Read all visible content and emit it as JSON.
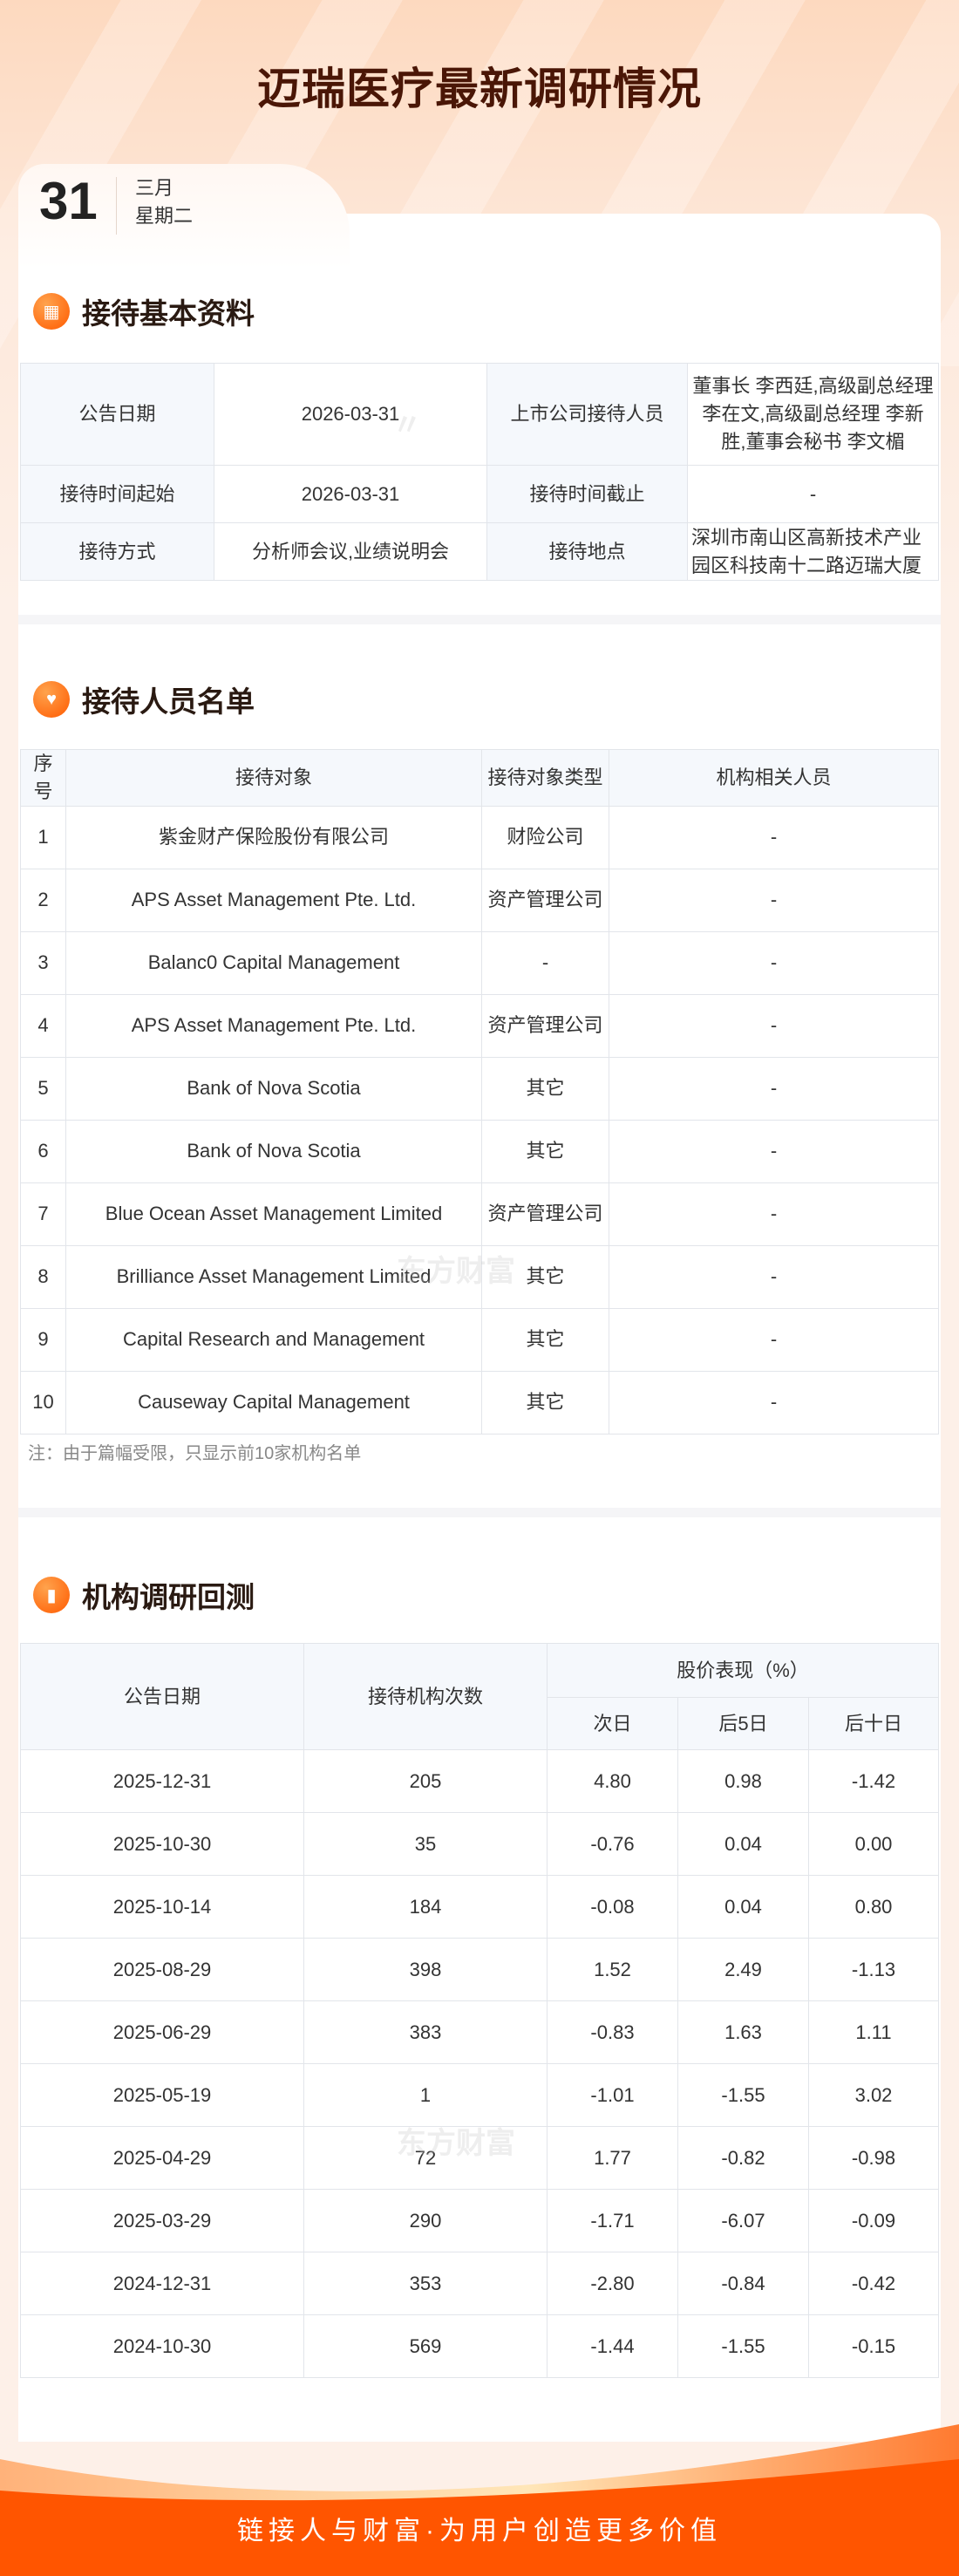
{
  "title": "迈瑞医疗最新调研情况",
  "date": {
    "day": "31",
    "month": "三月",
    "weekday": "星期二"
  },
  "section1": {
    "title": "接待基本资料",
    "rows": [
      [
        "公告日期",
        "2026-03-31",
        "上市公司接待人员",
        "董事长 李西廷,高级副总经理 李在文,高级副总经理 李新胜,董事会秘书 李文楣"
      ],
      [
        "接待时间起始",
        "2026-03-31",
        "接待时间截止",
        "-"
      ],
      [
        "接待方式",
        "分析师会议,业绩说明会",
        "接待地点",
        "深圳市南山区高新技术产业园区科技南十二路迈瑞大厦"
      ]
    ]
  },
  "section2": {
    "title": "接待人员名单",
    "headers": [
      "序号",
      "接待对象",
      "接待对象类型",
      "机构相关人员"
    ],
    "rows": [
      [
        "1",
        "紫金财产保险股份有限公司",
        "财险公司",
        "-"
      ],
      [
        "2",
        "APS Asset Management Pte. Ltd.",
        "资产管理公司",
        "-"
      ],
      [
        "3",
        "Balanc0 Capital Management",
        "-",
        "-"
      ],
      [
        "4",
        "APS Asset Management Pte. Ltd.",
        "资产管理公司",
        "-"
      ],
      [
        "5",
        "Bank of Nova Scotia",
        "其它",
        "-"
      ],
      [
        "6",
        "Bank of Nova Scotia",
        "其它",
        "-"
      ],
      [
        "7",
        "Blue Ocean Asset Management Limited",
        "资产管理公司",
        "-"
      ],
      [
        "8",
        "Brilliance Asset Management Limited",
        "其它",
        "-"
      ],
      [
        "9",
        "Capital Research and Management",
        "其它",
        "-"
      ],
      [
        "10",
        "Causeway Capital Management",
        "其它",
        "-"
      ]
    ],
    "note": "注：由于篇幅受限，只显示前10家机构名单"
  },
  "section3": {
    "title": "机构调研回测",
    "headers": {
      "date": "公告日期",
      "count": "接待机构次数",
      "perf": "股价表现（%）",
      "d1": "次日",
      "d5": "后5日",
      "d10": "后十日"
    },
    "rows": [
      [
        "2025-12-31",
        "205",
        "4.80",
        "0.98",
        "-1.42"
      ],
      [
        "2025-10-30",
        "35",
        "-0.76",
        "0.04",
        "0.00"
      ],
      [
        "2025-10-14",
        "184",
        "-0.08",
        "0.04",
        "0.80"
      ],
      [
        "2025-08-29",
        "398",
        "1.52",
        "2.49",
        "-1.13"
      ],
      [
        "2025-06-29",
        "383",
        "-0.83",
        "1.63",
        "1.11"
      ],
      [
        "2025-05-19",
        "1",
        "-1.01",
        "-1.55",
        "3.02"
      ],
      [
        "2025-04-29",
        "72",
        "1.77",
        "-0.82",
        "-0.98"
      ],
      [
        "2025-03-29",
        "290",
        "-1.71",
        "-6.07",
        "-0.09"
      ],
      [
        "2024-12-31",
        "353",
        "-2.80",
        "-0.84",
        "-0.42"
      ],
      [
        "2024-10-30",
        "569",
        "-1.44",
        "-1.55",
        "-0.15"
      ]
    ]
  },
  "watermark": "东方财富",
  "footer": {
    "slogan": "链接人与财富·为用户创造更多价值"
  },
  "colors": {
    "accent": "#ff5500",
    "title": "#4a1606"
  }
}
